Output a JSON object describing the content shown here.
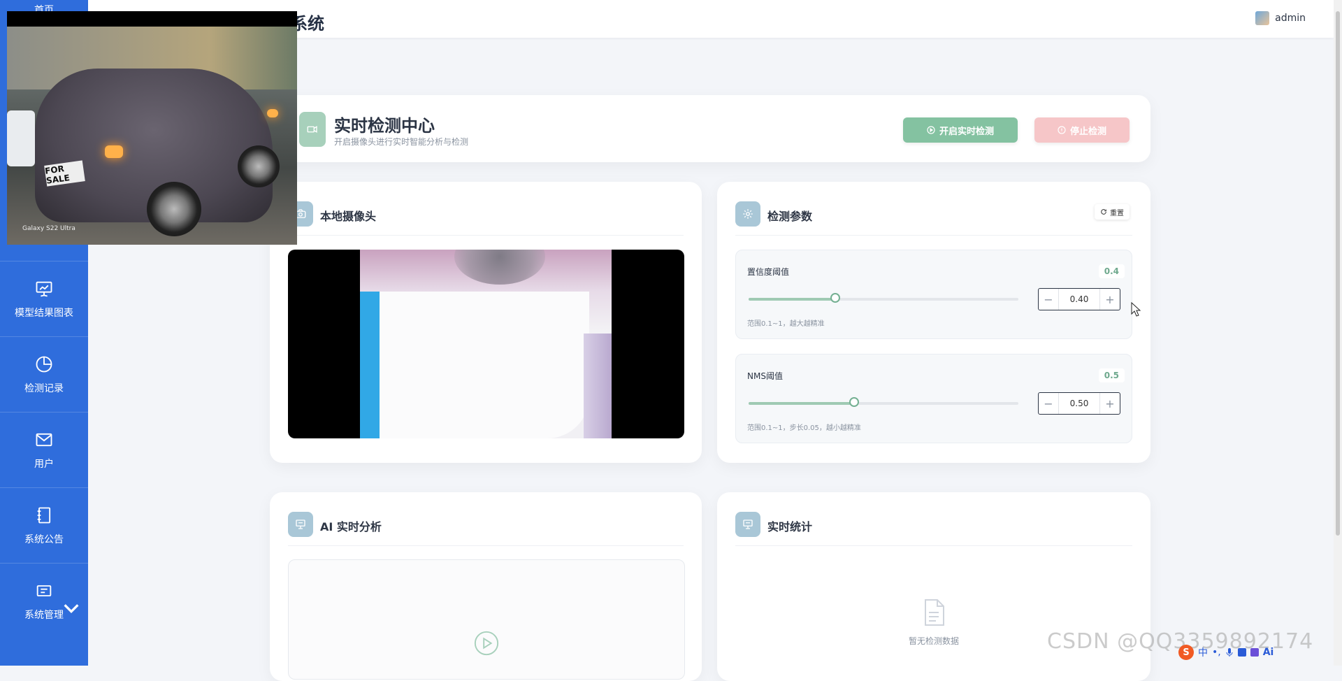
{
  "sidebar": {
    "top_label": "首页",
    "items": [
      {
        "label": "模型结果图表",
        "icon": "presentation-chart-icon"
      },
      {
        "label": "检测记录",
        "icon": "pie-chart-icon"
      },
      {
        "label": "用户",
        "icon": "mail-icon"
      },
      {
        "label": "系统公告",
        "icon": "notebook-icon"
      },
      {
        "label": "系统管理",
        "icon": "message-card-icon"
      }
    ]
  },
  "header": {
    "title_fragment": "系统",
    "username": "admin"
  },
  "overlay": {
    "plate_text": "FOR SALE",
    "watermark": "Galaxy S22 Ultra"
  },
  "hero": {
    "title": "实时检测中心",
    "subtitle": "开启摄像头进行实时智能分析与检测",
    "start_label": "开启实时检测",
    "stop_label": "停止检测"
  },
  "camera_card": {
    "title": "本地摄像头"
  },
  "params_card": {
    "title": "检测参数",
    "reset_label": "重置",
    "confidence": {
      "label": "置信度阈值",
      "badge": "0.4",
      "value": "0.40",
      "level": 0.4,
      "hint": "范围0.1~1，越大越精准"
    },
    "nms": {
      "label": "NMS阈值",
      "badge": "0.5",
      "value": "0.50",
      "level": 0.5,
      "hint": "范围0.1~1，步长0.05，越小越精准"
    }
  },
  "ai_card": {
    "title": "AI 实时分析"
  },
  "stats_card": {
    "title": "实时统计",
    "empty_text": "暂无检测数据"
  },
  "watermark": {
    "text": "CSDN @QQ3359892174"
  },
  "ime": {
    "logo": "S",
    "lang": "中",
    "ai": "Ai"
  },
  "colors": {
    "sidebar": "#2f6ddc",
    "start_button": "#84c2a1",
    "stop_button": "#f6c6c8",
    "accent_green": "#6fa98e"
  }
}
